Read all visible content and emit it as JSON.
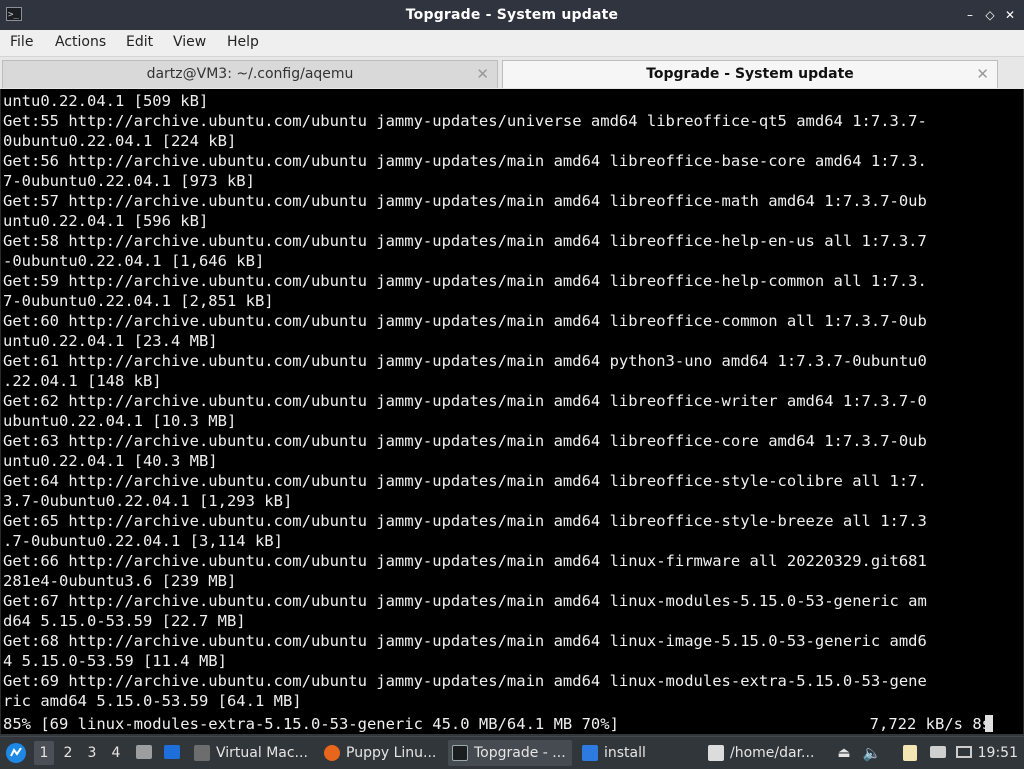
{
  "window": {
    "title": "Topgrade - System update",
    "controls": {
      "minimize": "–",
      "restore": "◇",
      "close": "✕"
    }
  },
  "menu": [
    "File",
    "Actions",
    "Edit",
    "View",
    "Help"
  ],
  "tabs": [
    {
      "label": "dartz@VM3: ~/.config/aqemu",
      "active": false
    },
    {
      "label": "Topgrade - System update",
      "active": true
    }
  ],
  "terminal": {
    "lines": [
      "untu0.22.04.1 [509 kB]",
      "Get:55 http://archive.ubuntu.com/ubuntu jammy-updates/universe amd64 libreoffice-qt5 amd64 1:7.3.7-",
      "0ubuntu0.22.04.1 [224 kB]",
      "Get:56 http://archive.ubuntu.com/ubuntu jammy-updates/main amd64 libreoffice-base-core amd64 1:7.3.",
      "7-0ubuntu0.22.04.1 [973 kB]",
      "Get:57 http://archive.ubuntu.com/ubuntu jammy-updates/main amd64 libreoffice-math amd64 1:7.3.7-0ub",
      "untu0.22.04.1 [596 kB]",
      "Get:58 http://archive.ubuntu.com/ubuntu jammy-updates/main amd64 libreoffice-help-en-us all 1:7.3.7",
      "-0ubuntu0.22.04.1 [1,646 kB]",
      "Get:59 http://archive.ubuntu.com/ubuntu jammy-updates/main amd64 libreoffice-help-common all 1:7.3.",
      "7-0ubuntu0.22.04.1 [2,851 kB]",
      "Get:60 http://archive.ubuntu.com/ubuntu jammy-updates/main amd64 libreoffice-common all 1:7.3.7-0ub",
      "untu0.22.04.1 [23.4 MB]",
      "Get:61 http://archive.ubuntu.com/ubuntu jammy-updates/main amd64 python3-uno amd64 1:7.3.7-0ubuntu0",
      ".22.04.1 [148 kB]",
      "Get:62 http://archive.ubuntu.com/ubuntu jammy-updates/main amd64 libreoffice-writer amd64 1:7.3.7-0",
      "ubuntu0.22.04.1 [10.3 MB]",
      "Get:63 http://archive.ubuntu.com/ubuntu jammy-updates/main amd64 libreoffice-core amd64 1:7.3.7-0ub",
      "untu0.22.04.1 [40.3 MB]",
      "Get:64 http://archive.ubuntu.com/ubuntu jammy-updates/main amd64 libreoffice-style-colibre all 1:7.",
      "3.7-0ubuntu0.22.04.1 [1,293 kB]",
      "Get:65 http://archive.ubuntu.com/ubuntu jammy-updates/main amd64 libreoffice-style-breeze all 1:7.3",
      ".7-0ubuntu0.22.04.1 [3,114 kB]",
      "Get:66 http://archive.ubuntu.com/ubuntu jammy-updates/main amd64 linux-firmware all 20220329.git681",
      "281e4-0ubuntu3.6 [239 MB]",
      "Get:67 http://archive.ubuntu.com/ubuntu jammy-updates/main amd64 linux-modules-5.15.0-53-generic am",
      "d64 5.15.0-53.59 [22.7 MB]",
      "Get:68 http://archive.ubuntu.com/ubuntu jammy-updates/main amd64 linux-image-5.15.0-53-generic amd6",
      "4 5.15.0-53.59 [11.4 MB]",
      "Get:69 http://archive.ubuntu.com/ubuntu jammy-updates/main amd64 linux-modules-extra-5.15.0-53-gene",
      "ric amd64 5.15.0-53.59 [64.1 MB]"
    ],
    "progress_line": "85% [69 linux-modules-extra-5.15.0-53-generic 45.0 MB/64.1 MB 70%]",
    "progress_rate": "7,722 kB/s 8s"
  },
  "taskbar": {
    "workspaces": [
      "1",
      "2",
      "3",
      "4"
    ],
    "active_workspace": "1",
    "tasks": [
      {
        "label": "Virtual Mac...",
        "icon": "virtualbox-icon",
        "active": false
      },
      {
        "label": "Puppy Linu...",
        "icon": "firefox-icon",
        "active": false
      },
      {
        "label": "Topgrade - ...",
        "icon": "terminal-icon",
        "active": true
      },
      {
        "label": "install",
        "icon": "folder-icon",
        "active": false
      },
      {
        "label": "/home/dar...",
        "icon": "text-editor-icon",
        "active": false
      }
    ],
    "clock": "19:51",
    "colors": {
      "panel": "#31363b",
      "terminal_bg": "#000000",
      "titlebar": "#2f343f"
    }
  }
}
